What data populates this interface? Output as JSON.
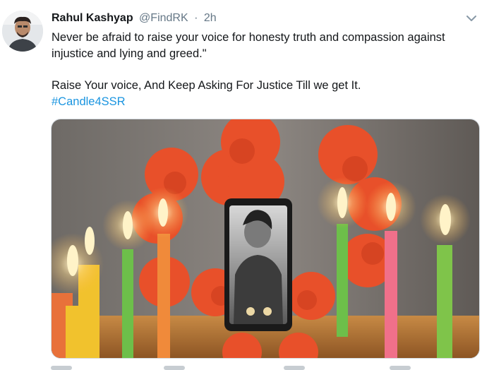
{
  "tweet": {
    "author_name": "Rahul Kashyap",
    "author_handle": "@FindRK",
    "separator": "·",
    "time": "2h",
    "text_line1": "Never be afraid to raise your voice for honesty truth and compassion against injustice and lying and greed.\"",
    "text_line2": "Raise Your voice, And Keep Asking For Justice Till we get It.",
    "hashtag": "#Candle4SSR"
  },
  "icons": {
    "more": "chevron-down-icon"
  },
  "colors": {
    "link": "#1b95e0",
    "text": "#14171a",
    "muted": "#657786"
  }
}
